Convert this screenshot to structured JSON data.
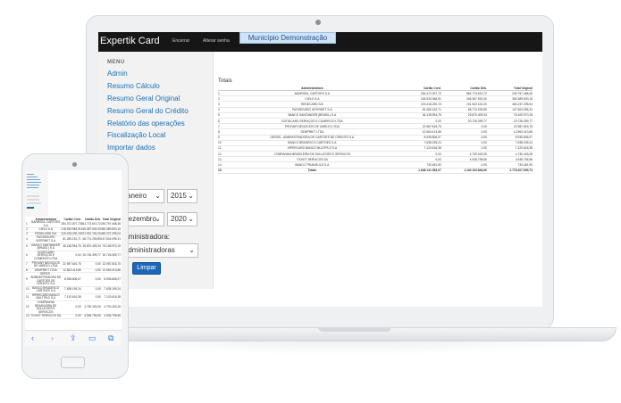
{
  "laptop": {
    "app_title": "Expertik Card",
    "nav": [
      "Encerrar",
      "Alterar senha"
    ],
    "municipality_tab": "Município Demonstração",
    "sidebar": {
      "title": "MENU",
      "items": [
        "Admin",
        "Resumo Cálculo",
        "Resumo Geral Original",
        "Resumo Geral do Crédito",
        "Relatório das operações",
        "Fiscalização Local",
        "Importar dados"
      ]
    },
    "filters": {
      "start_month": "Janeiro",
      "start_year": "2015",
      "end_month": "Dezembro",
      "end_year": "2020",
      "admin_label": "Administradora:",
      "admin_value": "Administradoras",
      "clear_button": "Limpar"
    },
    "report": {
      "totals_label": "Totais",
      "columns": [
        "",
        "Administradora",
        "Cartão Cred.",
        "Cartão Déb.",
        "Total Original"
      ],
      "rows": [
        [
          "1",
          "BANRISUL CARTOES S.A",
          "284.372.007,72",
          "564.773.610,72",
          "249.797.468,46"
        ],
        [
          "2",
          "CIELO S.A",
          "218.933.948,91",
          "246.387.932,00",
          "350.389.500,15"
        ],
        [
          "3",
          "REDECARD S/A",
          "219.418.230,19",
          "191.922.100,20",
          "460.237.295,04"
        ],
        [
          "4",
          "PAGSEGURO INTERNET S.A",
          "81.280.152,71",
          "68.774.293,89",
          "147.504.095,31"
        ],
        [
          "5",
          "BANCO SANTANDER (BRASIL) S.A",
          "46.135.994,76",
          "29.870.409,34",
          "76.105.970,15"
        ],
        [
          "6",
          "GOODCARD SERVIÇOS E COMERCIO LTDA",
          "0,00",
          "20.726.399,77",
          "20.726.399,77"
        ],
        [
          "7",
          "PROVAR NEGOCIOS DE VAREJO LTDA",
          "22.987.816,75",
          "0,00",
          "22.987.816,75"
        ],
        [
          "8",
          "SEMPREIT LTDA",
          "12.563.413,86",
          "0,00",
          "12.563.413,86"
        ],
        [
          "9",
          "GERDS - ADMINISTRADORA DE CARTOES DE CREDITO S.A",
          "8.935.806,07",
          "0,00",
          "8.935.806,07"
        ],
        [
          "10",
          "BANCO BRADESCO CARTOES S.A",
          "7.638.195,24",
          "0,00",
          "7.638.195,24"
        ],
        [
          "11",
          "HIPERCARD BANCO MULTIPLO S.A",
          "7.120.616,38",
          "0,00",
          "7.120.616,38"
        ],
        [
          "12",
          "COMPANHIA BRASILEIRA DE SOLUCOES E SERVICOS",
          "0,00",
          "4.730.433,26",
          "4.730.433,26"
        ],
        [
          "13",
          "TICKET SERVICOS SA",
          "0,00",
          "4.936.796,56",
          "4.936.796,56"
        ],
        [
          "14",
          "BANCO TRIANGULO S.A",
          "733.481,90",
          "0,00",
          "733.481,90"
        ],
        [
          "15",
          "Totais",
          "1.648.141.053,07",
          "1.130.103.846,60",
          "2.778.207.599,73"
        ]
      ]
    }
  },
  "phone": {
    "columns": [
      "",
      "Administradora",
      "Cartão Cred.",
      "Cartão Déb.",
      "Total Original"
    ],
    "rows": [
      [
        "1",
        "BANRISUL CARTOES S.A",
        "284.372.007,72",
        "564.773.610,72",
        "249.797.468,46"
      ],
      [
        "2",
        "CIELO S.A",
        "218.933.948,91",
        "246.387.932,00",
        "350.389.500,15"
      ],
      [
        "3",
        "REDECARD S/A",
        "219.418.230,19",
        "191.922.100,20",
        "460.237.295,04"
      ],
      [
        "4",
        "PAGSEGURO INTERNET S.A",
        "81.280.152,71",
        "68.774.293,89",
        "147.504.095,31"
      ],
      [
        "5",
        "BANCO SANTANDER (BRASIL) S.A",
        "46.135.994,76",
        "29.870.409,34",
        "76.105.970,15"
      ],
      [
        "6",
        "GOODCARD SERVIÇOS E COMERCIO LTDA",
        "0,00",
        "20.726.399,77",
        "20.726.399,77"
      ],
      [
        "7",
        "PROVAR NEGOCIOS DE VAREJO LTDA",
        "22.987.816,75",
        "0,00",
        "22.987.816,75"
      ],
      [
        "8",
        "SEMPREIT LTDA",
        "12.563.413,86",
        "0,00",
        "12.563.413,86"
      ],
      [
        "9",
        "GERDS - ADMINISTRADORA DE CARTOES DE CREDITO S.A",
        "8.935.806,07",
        "0,00",
        "8.935.806,07"
      ],
      [
        "10",
        "BANCO BRADESCO CARTOES S.A",
        "7.638.195,24",
        "0,00",
        "7.638.195,24"
      ],
      [
        "11",
        "HIPERCARD BANCO MULTIPLO S.A",
        "7.120.616,38",
        "0,00",
        "7.120.616,38"
      ],
      [
        "12",
        "COMPANHIA BRASILEIRA DE SOLUCOES E SERVICOS",
        "0,00",
        "4.730.433,26",
        "4.730.433,26"
      ],
      [
        "13",
        "TICKET SERVICOS SA",
        "0,00",
        "4.936.796,56",
        "4.936.796,56"
      ]
    ],
    "toolbar_icons": [
      "back-icon",
      "forward-icon",
      "share-icon",
      "bookmarks-icon",
      "tabs-icon"
    ]
  },
  "colors": {
    "brand_bar": "#161616",
    "link": "#1a6fb3",
    "primary_button": "#1c68b7",
    "municipality_tab": "#d0e4f6"
  }
}
